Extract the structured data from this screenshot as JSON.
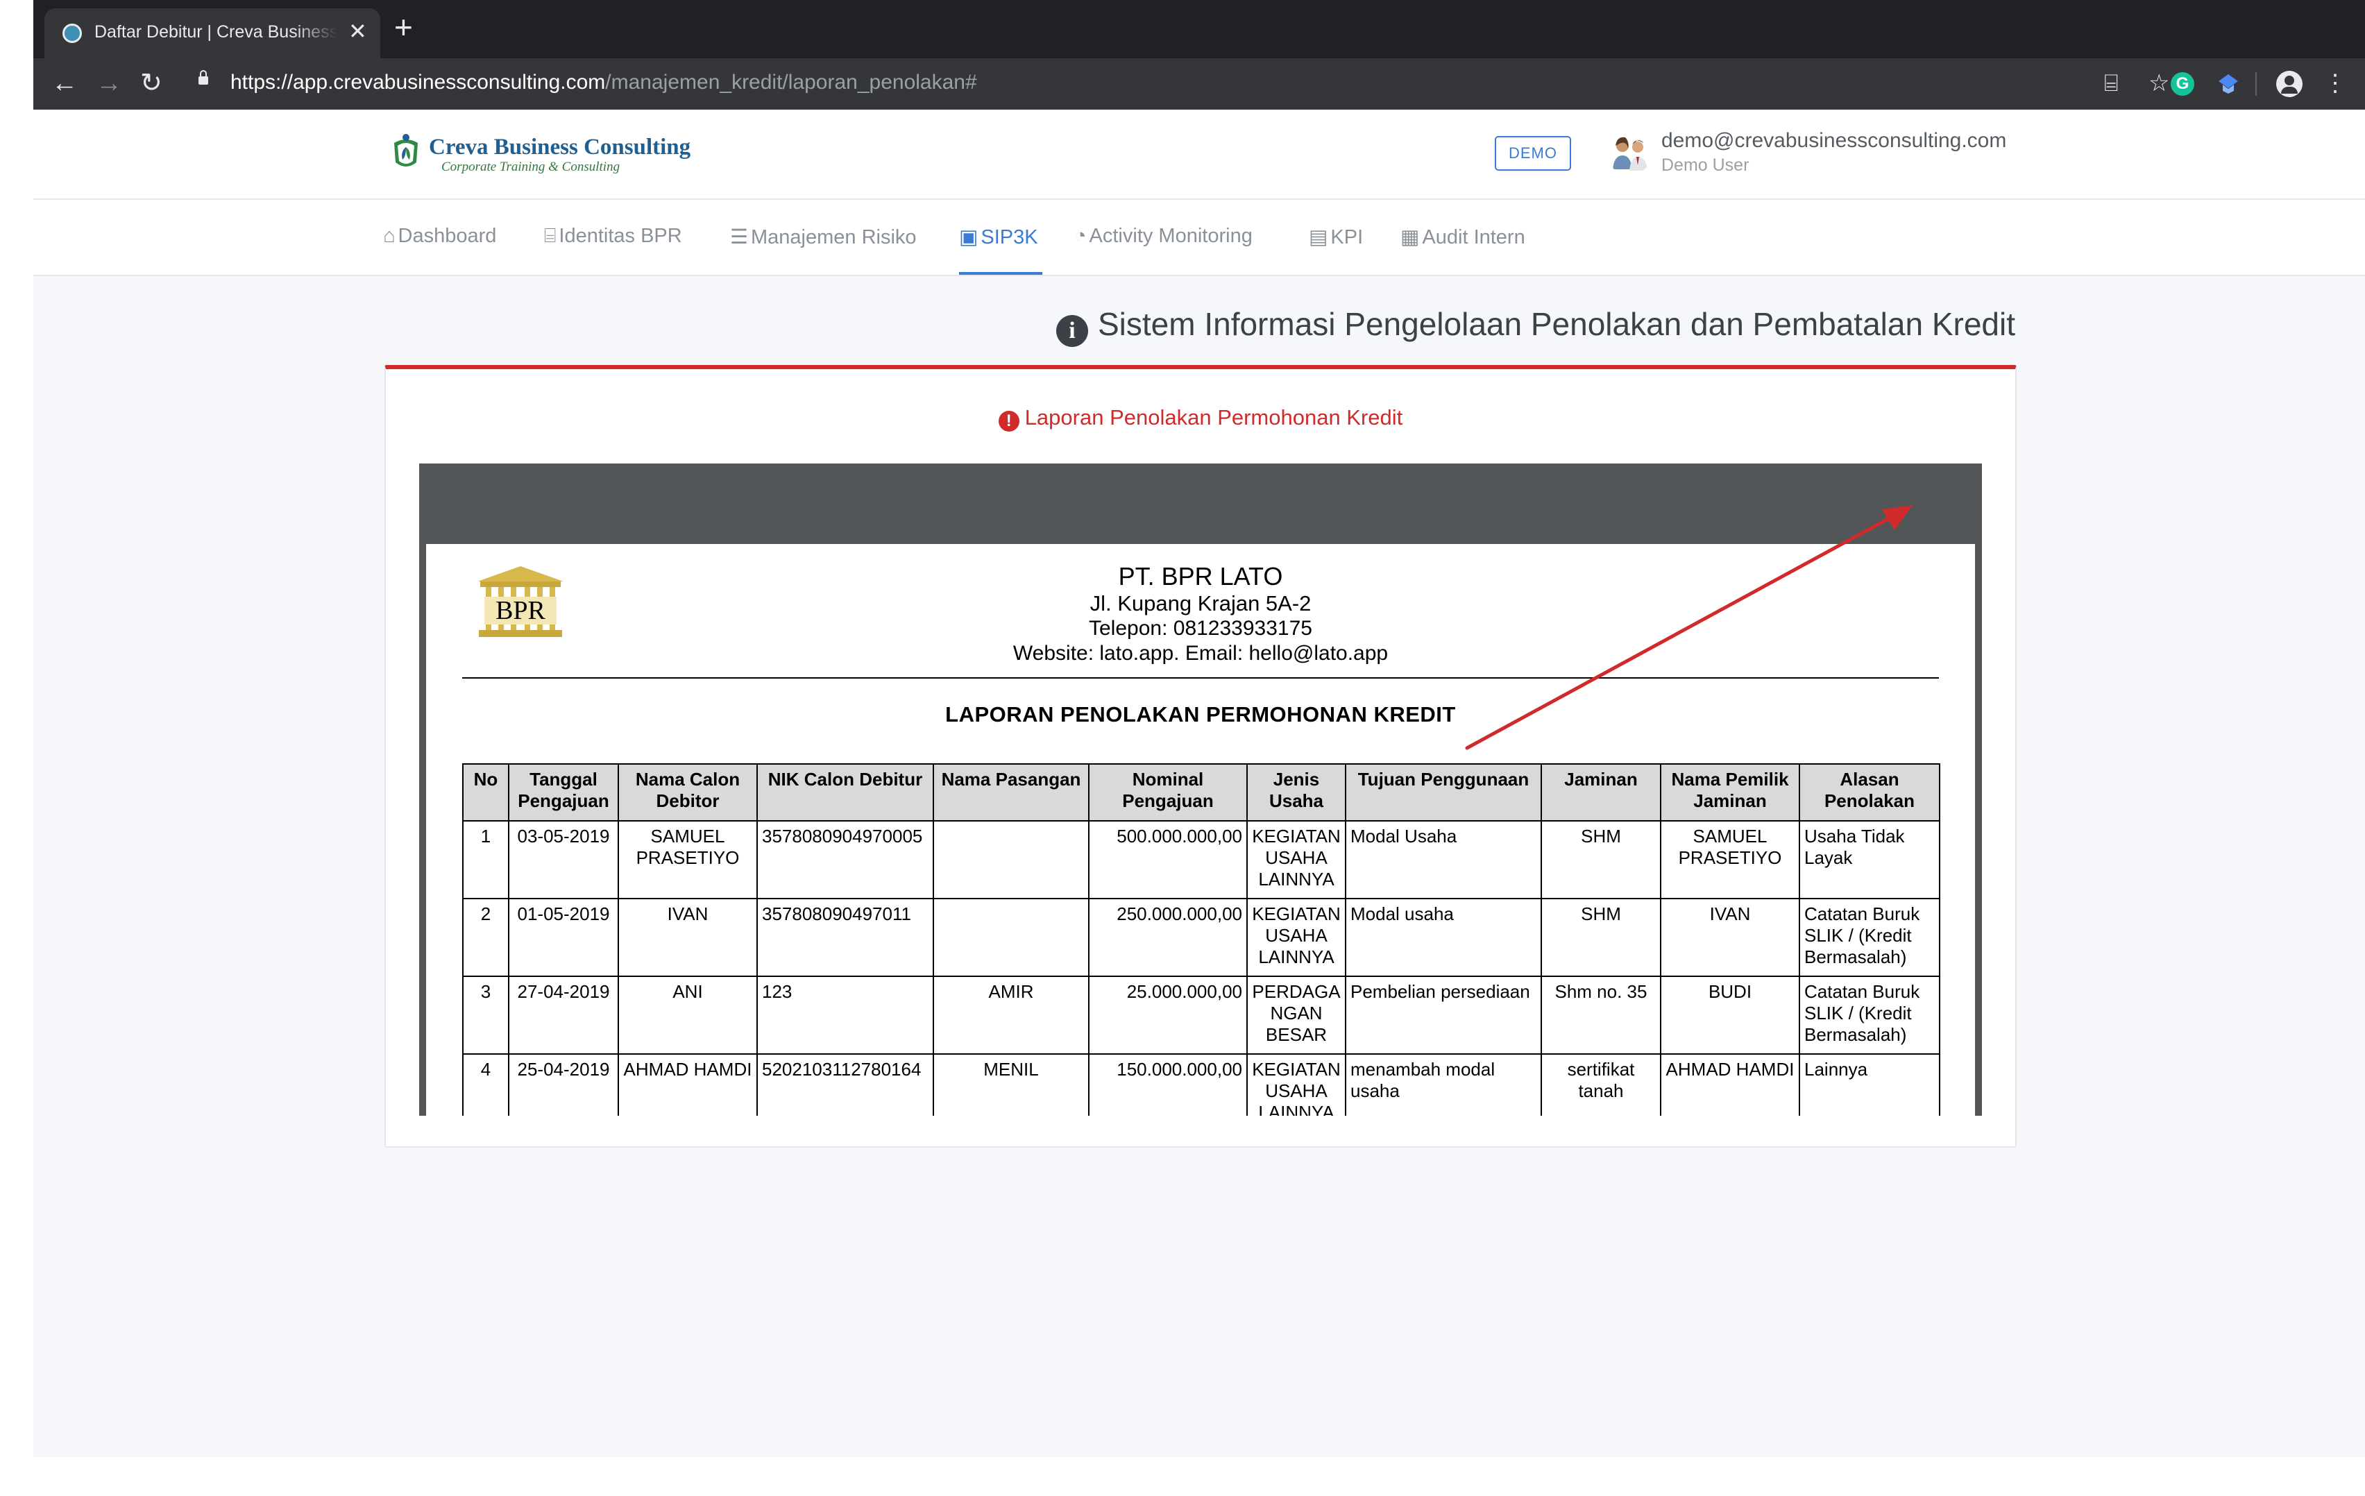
{
  "browser": {
    "tab_title": "Daftar Debitur | Creva Business Consulting",
    "tab_close": "✕",
    "new_tab": "+",
    "back_icon": "←",
    "forward_icon": "→",
    "reload_icon": "↻",
    "url_host": "https://app.crevabusinessconsulting.com",
    "url_path": "/manajemen_kredit/laporan_penolakan#",
    "translate_icon": "⌸",
    "star_icon": "☆",
    "grammarly_letter": "G",
    "menu_icon": "⋮"
  },
  "header": {
    "logo_title": "Creva Business Consulting",
    "logo_subtitle": "Corporate Training & Consulting",
    "demo_badge": "DEMO",
    "user_email": "demo@crevabusinessconsulting.com",
    "user_role": "Demo User"
  },
  "menu": {
    "items": [
      {
        "icon": "home-icon",
        "glyph": "⌂",
        "label": "Dashboard"
      },
      {
        "icon": "bank-icon",
        "glyph": "⌸",
        "label": "Identitas BPR"
      },
      {
        "icon": "list-icon",
        "glyph": "☰",
        "label": "Manajemen Risiko"
      },
      {
        "icon": "contact-book-icon",
        "glyph": "▣",
        "label": "SIP3K"
      },
      {
        "icon": "dashboard-gauge-icon",
        "glyph": "◔",
        "label": "Activity Monitoring"
      },
      {
        "icon": "clipboard-icon",
        "glyph": "▤",
        "label": "KPI"
      },
      {
        "icon": "calendar-check-icon",
        "glyph": "▦",
        "label": "Audit Intern"
      }
    ],
    "active_index": 3
  },
  "page": {
    "title_glyph": "i",
    "title": "Sistem Informasi Pengelolaan Penolakan dan Pembatalan Kredit",
    "card_glyph": "!",
    "card_title": "Laporan Penolakan Permohonan Kredit"
  },
  "report": {
    "logo_text": "BPR",
    "org_name": "PT. BPR LATO",
    "address": "Jl. Kupang Krajan 5A-2",
    "phone": "Telepon: 081233933175",
    "contact": "Website: lato.app. Email: hello@lato.app",
    "title": "LAPORAN PENOLAKAN PERMOHONAN KREDIT",
    "columns": [
      "No",
      "Tanggal Pengajuan",
      "Nama Calon Debitor",
      "NIK Calon Debitur",
      "Nama Pasangan",
      "Nominal Pengajuan",
      "Jenis Usaha",
      "Tujuan Penggunaan",
      "Jaminan",
      "Nama Pemilik Jaminan",
      "Alasan Penolakan"
    ],
    "rows": [
      [
        "1",
        "03-05-2019",
        "SAMUEL PRASETIYO",
        "3578080904970005",
        "",
        "500.000.000,00",
        "KEGIATAN USAHA LAINNYA",
        "Modal Usaha",
        "SHM",
        "SAMUEL PRASETIYO",
        "Usaha Tidak Layak"
      ],
      [
        "2",
        "01-05-2019",
        "IVAN",
        "357808090497011",
        "",
        "250.000.000,00",
        "KEGIATAN USAHA LAINNYA",
        "Modal usaha",
        "SHM",
        "IVAN",
        "Catatan Buruk SLIK / (Kredit Bermasalah)"
      ],
      [
        "3",
        "27-04-2019",
        "ANI",
        "123",
        "AMIR",
        "25.000.000,00",
        "PERDAGANGAN BESAR",
        "Pembelian persediaan",
        "Shm no. 35",
        "BUDI",
        "Catatan Buruk SLIK / (Kredit Bermasalah)"
      ],
      [
        "4",
        "25-04-2019",
        "AHMAD HAMDI",
        "5202103112780164",
        "MENIL",
        "150.000.000,00",
        "KEGIATAN USAHA LAINNYA",
        "menambah modal usaha",
        "sertifikat tanah",
        "AHMAD HAMDI",
        "Lainnya"
      ]
    ]
  },
  "colors": {
    "accent_blue": "#3a7bd5",
    "alert_red": "#d12a2a",
    "viewer_gray": "#525659"
  }
}
